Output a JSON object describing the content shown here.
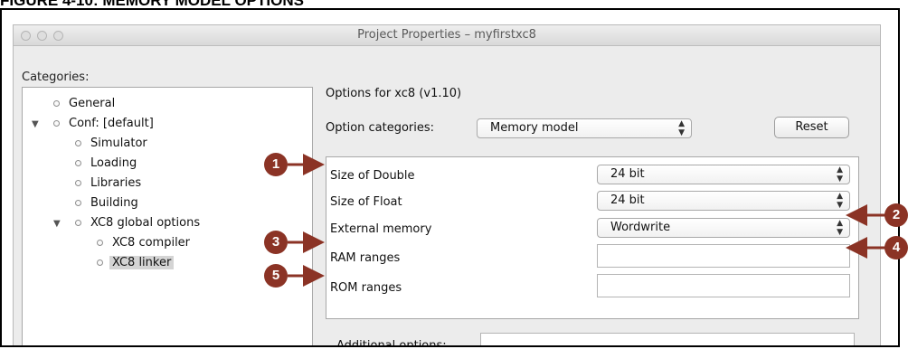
{
  "figure_title": "FIGURE 4-10:        MEMORY MODEL OPTIONS",
  "window": {
    "title": "Project Properties – myfirstxc8",
    "traffic_lights": [
      "close",
      "minimize",
      "zoom"
    ]
  },
  "sidebar": {
    "label": "Categories:",
    "items": [
      {
        "label": "General",
        "level": 1,
        "expanded": null,
        "selected": false
      },
      {
        "label": "Conf: [default]",
        "level": 1,
        "expanded": true,
        "selected": false
      },
      {
        "label": "Simulator",
        "level": 2,
        "expanded": null,
        "selected": false
      },
      {
        "label": "Loading",
        "level": 2,
        "expanded": null,
        "selected": false
      },
      {
        "label": "Libraries",
        "level": 2,
        "expanded": null,
        "selected": false
      },
      {
        "label": "Building",
        "level": 2,
        "expanded": null,
        "selected": false
      },
      {
        "label": "XC8 global options",
        "level": 2,
        "expanded": true,
        "selected": false
      },
      {
        "label": "XC8 compiler",
        "level": 3,
        "expanded": null,
        "selected": false
      },
      {
        "label": "XC8 linker",
        "level": 3,
        "expanded": null,
        "selected": true
      }
    ]
  },
  "main": {
    "options_title": "Options for xc8 (v1.10)",
    "option_categories_label": "Option categories:",
    "option_categories_value": "Memory model",
    "reset_label": "Reset",
    "rows": [
      {
        "label": "Size of Double",
        "type": "select",
        "value": "24 bit"
      },
      {
        "label": "Size of Float",
        "type": "select",
        "value": "24 bit"
      },
      {
        "label": "External memory",
        "type": "select",
        "value": "Wordwrite"
      },
      {
        "label": "RAM ranges",
        "type": "text",
        "value": ""
      },
      {
        "label": "ROM ranges",
        "type": "text",
        "value": ""
      }
    ],
    "additional_options_label": "Additional options:",
    "additional_options_value": ""
  },
  "callouts": [
    "1",
    "2",
    "3",
    "4",
    "5"
  ],
  "colors": {
    "callout": "#8b3325",
    "selection": "#d4d4d4"
  }
}
